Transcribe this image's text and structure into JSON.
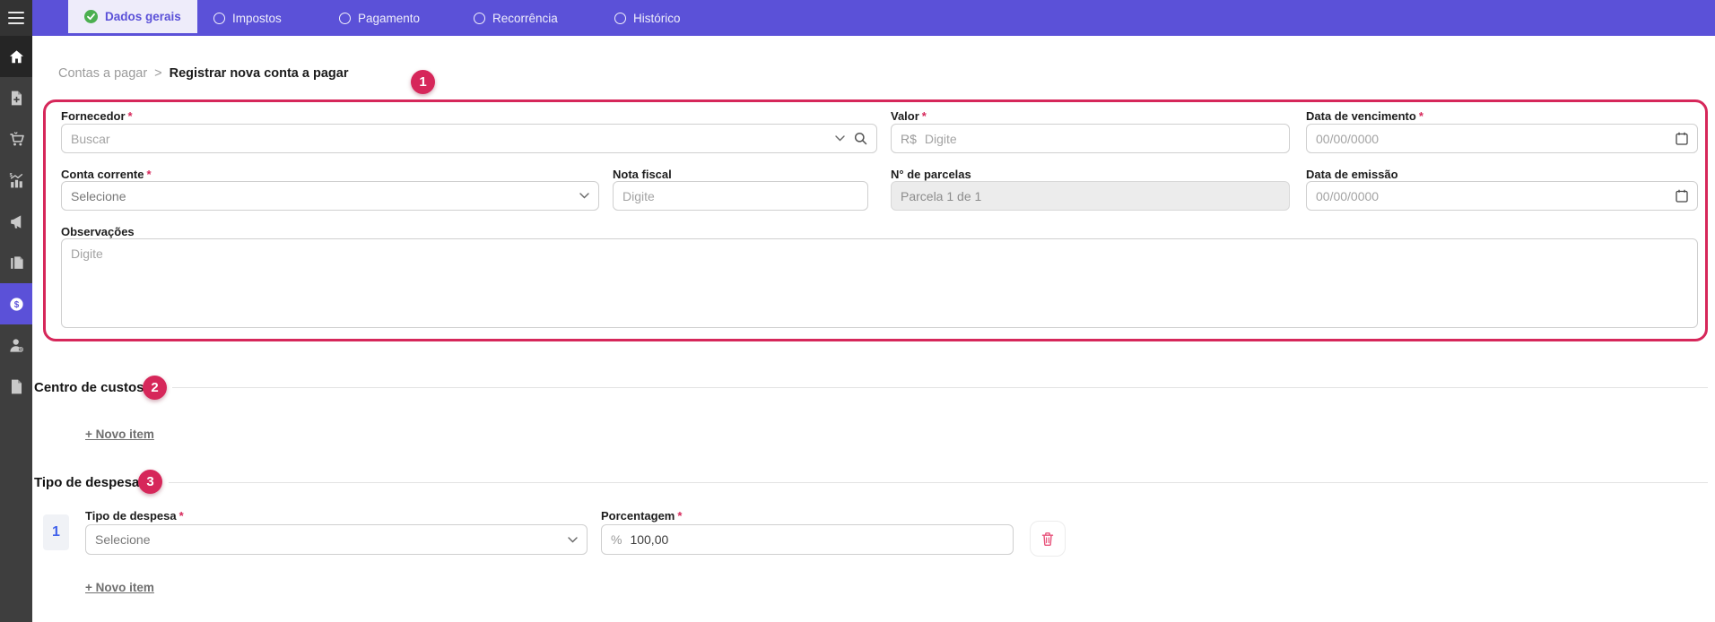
{
  "topbar": {
    "tabs": [
      {
        "label": "Dados gerais",
        "state": "active",
        "icon": "check-circle-icon"
      },
      {
        "label": "Impostos",
        "state": "default",
        "icon": "radio-circle-icon"
      },
      {
        "label": "Pagamento",
        "state": "default",
        "icon": "radio-circle-icon"
      },
      {
        "label": "Recorrência",
        "state": "default",
        "icon": "radio-circle-icon"
      },
      {
        "label": "Histórico",
        "state": "default",
        "icon": "radio-circle-icon"
      }
    ]
  },
  "sidebar": {
    "items": [
      {
        "icon": "home-icon",
        "active": false
      },
      {
        "icon": "file-plus-icon",
        "active": false
      },
      {
        "icon": "cart-icon",
        "active": false
      },
      {
        "icon": "sales-chart-icon",
        "active": false
      },
      {
        "icon": "megaphone-icon",
        "active": false
      },
      {
        "icon": "documents-icon",
        "active": false
      },
      {
        "icon": "dollar-circle-icon",
        "active": true
      },
      {
        "icon": "person-dollar-icon",
        "active": false
      },
      {
        "icon": "file-icon",
        "active": false
      }
    ]
  },
  "breadcrumb": {
    "parent": "Contas a pagar",
    "separator": ">",
    "current": "Registrar nova conta a pagar"
  },
  "annotations": {
    "one": "1",
    "two": "2",
    "three": "3"
  },
  "form": {
    "fornecedor": {
      "label": "Fornecedor",
      "required": "*",
      "placeholder": "Buscar"
    },
    "valor": {
      "label": "Valor",
      "required": "*",
      "prefix": "R$",
      "placeholder": "Digite"
    },
    "data_vencimento": {
      "label": "Data de vencimento",
      "required": "*",
      "placeholder": "00/00/0000"
    },
    "conta_corrente": {
      "label": "Conta corrente",
      "required": "*",
      "value": "Selecione"
    },
    "nota_fiscal": {
      "label": "Nota fiscal",
      "placeholder": "Digite"
    },
    "parcelas": {
      "label": "N° de parcelas",
      "value": "Parcela 1 de 1"
    },
    "data_emissao": {
      "label": "Data de emissão",
      "placeholder": "00/00/0000"
    },
    "observacoes": {
      "label": "Observações",
      "placeholder": "Digite"
    }
  },
  "centro_custos": {
    "title": "Centro de custos",
    "new_item": "+ Novo item"
  },
  "tipo_despesa": {
    "title": "Tipo de despesa",
    "new_item": "+ Novo item",
    "row": {
      "index": "1",
      "tipo_label": "Tipo de despesa",
      "required": "*",
      "tipo_value": "Selecione",
      "pct_label": "Porcentagem",
      "pct_required": "*",
      "pct_prefix": "%",
      "pct_value": "100,00"
    }
  },
  "colors": {
    "topbar_purple": "#5b51d8",
    "active_tab_bg": "#eeecfa",
    "check_green": "#4caf50",
    "annotation_red": "#d6275a",
    "sidebar_grey": "#3e3e3e",
    "badge_blue": "#4263eb",
    "trash_pink": "#e8547c"
  }
}
